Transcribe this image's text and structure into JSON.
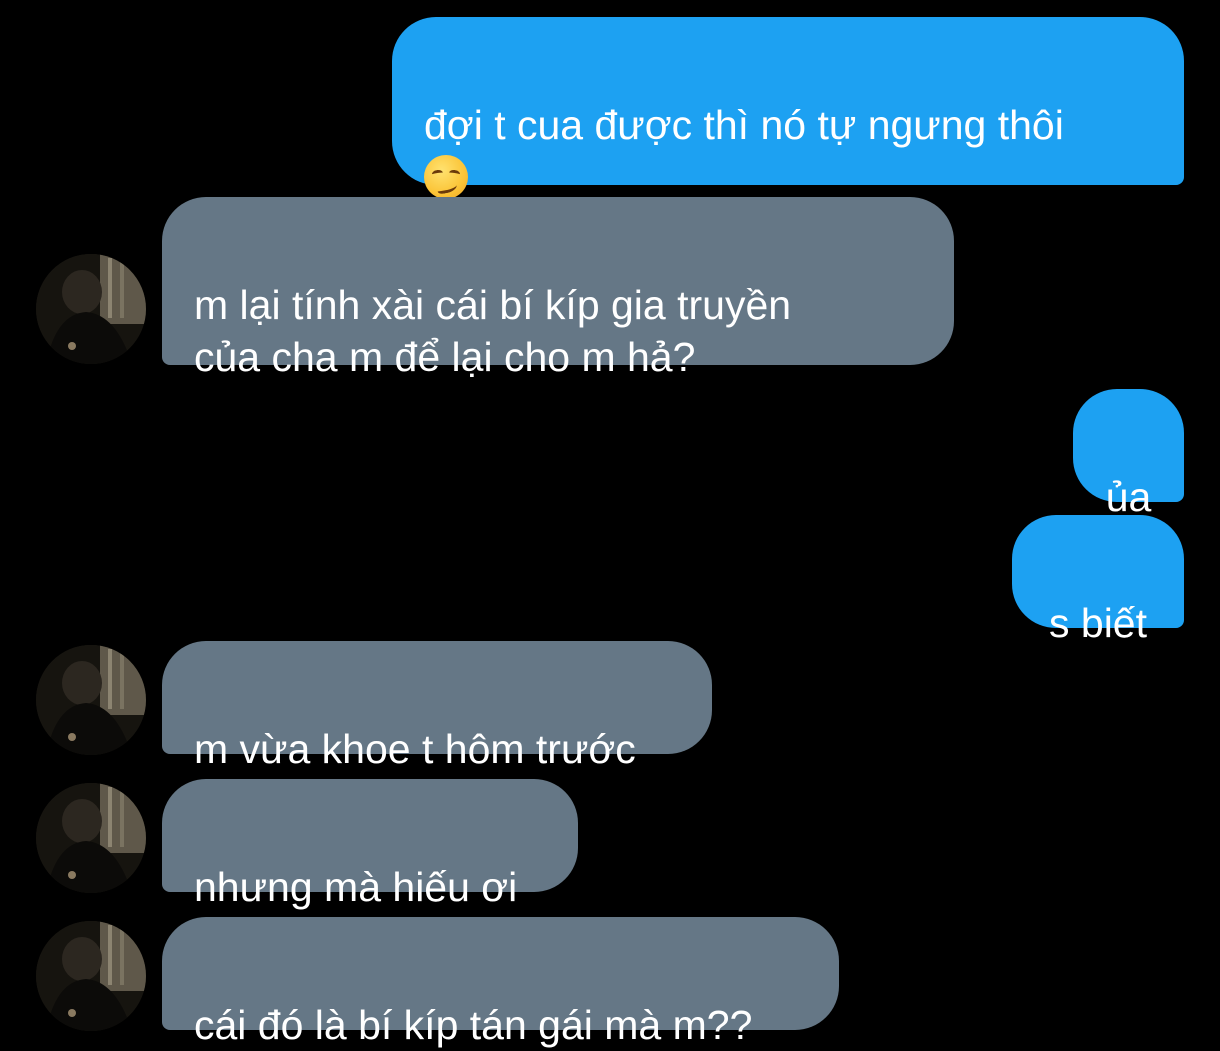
{
  "messages": [
    {
      "direction": "sent",
      "text": "đợi t cua được thì nó tự ngưng thôi",
      "emoji": "smirking-face"
    },
    {
      "direction": "received",
      "text": "m lại tính xài cái bí kíp gia truyền\ncủa cha m để lại cho m hả?"
    },
    {
      "direction": "sent",
      "text": "ủa"
    },
    {
      "direction": "sent",
      "text": "s biết"
    },
    {
      "direction": "received",
      "text": "m vừa khoe t hôm trước"
    },
    {
      "direction": "received",
      "text": "nhưng mà hiếu ơi"
    },
    {
      "direction": "received",
      "text": "cái đó là bí kíp tán gái mà m??"
    }
  ],
  "colors": {
    "background": "#000000",
    "sent_bubble": "#1da1f2",
    "received_bubble": "#657786",
    "text": "#ffffff"
  }
}
